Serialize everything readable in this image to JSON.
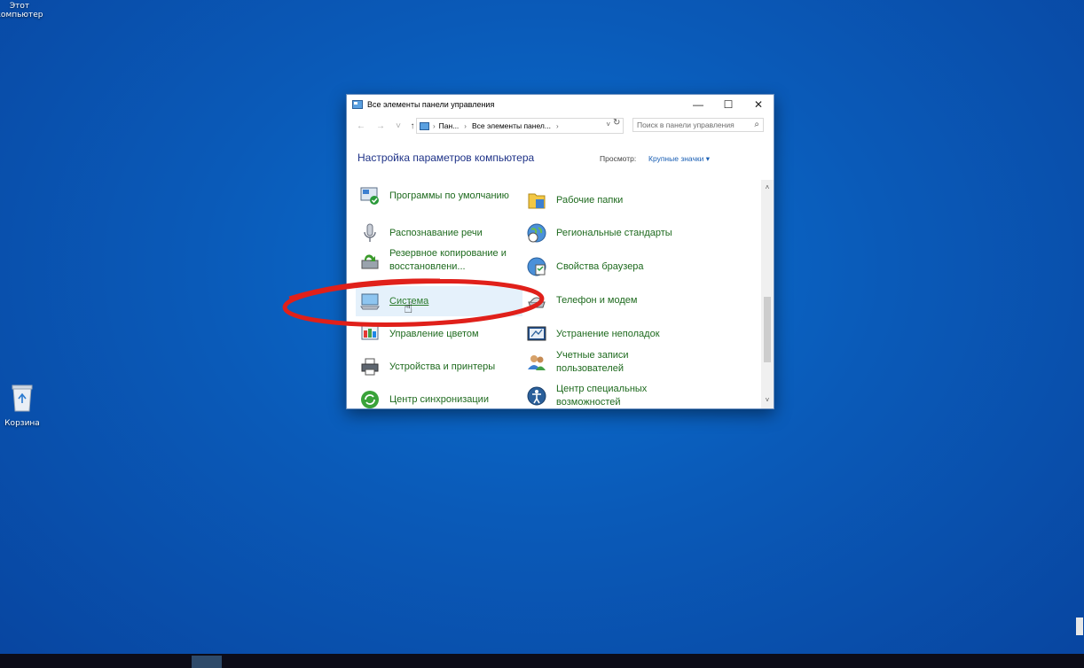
{
  "desktop": {
    "this_pc": "Этот компьютер",
    "recycle_bin": "Корзина"
  },
  "window": {
    "title": "Все элементы панели управления",
    "controls": {
      "minimize": "—",
      "maximize": "☐",
      "close": "✕"
    },
    "address": {
      "crumbs": [
        "Пан...",
        "Все элементы панел..."
      ],
      "search_placeholder": "Поиск в панели управления"
    },
    "page_title": "Настройка параметров компьютера",
    "view_label": "Просмотр:",
    "view_value": "Крупные значки ▾",
    "items": [
      {
        "label": "Программы по умолчанию",
        "icon": "default-programs-icon"
      },
      {
        "label": "Рабочие папки",
        "icon": "work-folders-icon"
      },
      {
        "label": "Распознавание речи",
        "icon": "microphone-icon"
      },
      {
        "label": "Региональные стандарты",
        "icon": "globe-clock-icon"
      },
      {
        "label": "Резервное копирование и восстановлени...",
        "icon": "backup-icon"
      },
      {
        "label": "Свойства браузера",
        "icon": "internet-options-icon"
      },
      {
        "label": "Система",
        "icon": "system-icon"
      },
      {
        "label": "Телефон и модем",
        "icon": "phone-modem-icon"
      },
      {
        "label": "Управление цветом",
        "icon": "color-management-icon"
      },
      {
        "label": "Устранение неполадок",
        "icon": "troubleshooting-icon"
      },
      {
        "label": "Устройства и принтеры",
        "icon": "printer-icon"
      },
      {
        "label": "Учетные записи пользователей",
        "icon": "user-accounts-icon"
      },
      {
        "label": "Центр синхронизации",
        "icon": "sync-center-icon"
      },
      {
        "label": "Центр специальных возможностей",
        "icon": "ease-of-access-icon"
      }
    ]
  },
  "colors": {
    "desktop": "#0a5ab8",
    "link_green": "#1e6a1e",
    "title_blue": "#1e3287",
    "annotation_red": "#e0201a"
  }
}
